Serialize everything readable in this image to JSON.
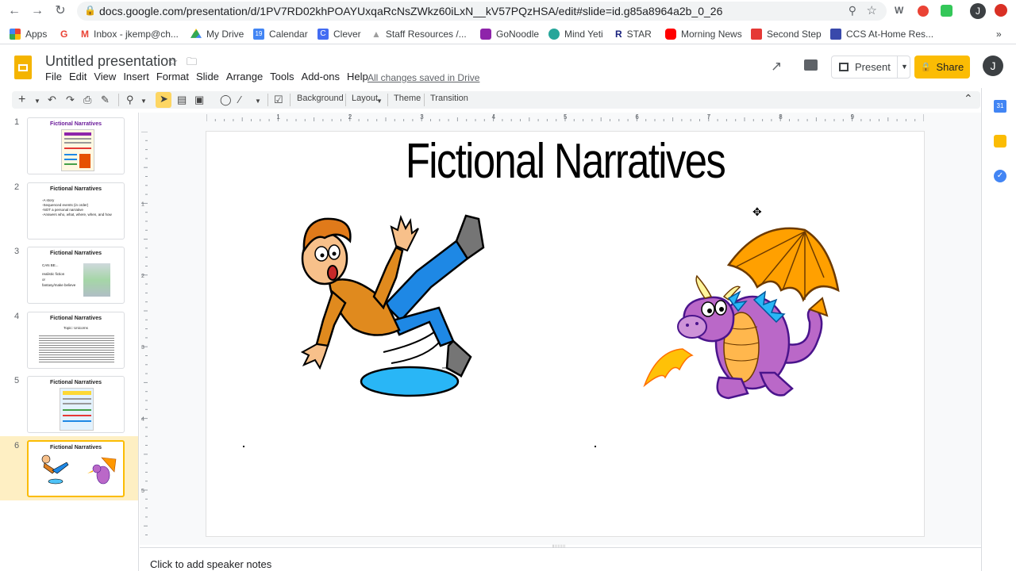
{
  "browser": {
    "url": "docs.google.com/presentation/d/1PV7RD02khPOAYUxqaRcNsZWkz60iLxN__kV57PQzHSA/edit#slide=id.g85a8964a2b_0_26",
    "bookmarks": [
      {
        "label": "Apps",
        "color": "#4285f4"
      },
      {
        "label": "Inbox - jkemp@ch...",
        "color": "#ea4335"
      },
      {
        "label": "My Drive",
        "color": "#34a853"
      },
      {
        "label": "Calendar",
        "color": "#4285f4"
      },
      {
        "label": "Clever",
        "color": "#436cf2"
      },
      {
        "label": "Staff Resources /...",
        "color": "#9e9e9e"
      },
      {
        "label": "GoNoodle",
        "color": "#8e24aa"
      },
      {
        "label": "Mind Yeti",
        "color": "#26a69a"
      },
      {
        "label": "STAR",
        "color": "#1a237e"
      },
      {
        "label": "Morning News",
        "color": "#ff0000"
      },
      {
        "label": "Second Step",
        "color": "#e53935"
      },
      {
        "label": "CCS At-Home Res...",
        "color": "#3949ab"
      }
    ],
    "more_bookmarks": "»",
    "profile_initial": "J"
  },
  "doc": {
    "title": "Untitled presentation",
    "menus": [
      "File",
      "Edit",
      "View",
      "Insert",
      "Format",
      "Slide",
      "Arrange",
      "Tools",
      "Add-ons",
      "Help"
    ],
    "saved_status": "All changes saved in Drive",
    "present_label": "Present",
    "share_label": "Share",
    "avatar_initial": "J"
  },
  "toolbar": {
    "background": "Background",
    "layout": "Layout",
    "theme": "Theme",
    "transition": "Transition"
  },
  "ruler": {
    "h_ticks": [
      "1",
      "2",
      "3",
      "4",
      "5",
      "6",
      "7",
      "8",
      "9"
    ],
    "v_ticks": [
      "1",
      "2",
      "3",
      "4",
      "5"
    ]
  },
  "slides": [
    {
      "num": "1",
      "title": "Fictional Narratives"
    },
    {
      "num": "2",
      "title": "Fictional Narratives",
      "lines": [
        "-A story",
        "-Sequenced events (in order)",
        "-NOT a personal narrative",
        "-Answers who, what, where, when, and how"
      ]
    },
    {
      "num": "3",
      "title": "Fictional Narratives",
      "lines": [
        "CAN BE...",
        "realistic fiction",
        "or",
        "fantasy/make believe"
      ]
    },
    {
      "num": "4",
      "title": "Fictional Narratives",
      "lines": [
        "Topic: Unicorns"
      ]
    },
    {
      "num": "5",
      "title": "Fictional Narratives"
    },
    {
      "num": "6",
      "title": "Fictional Narratives"
    }
  ],
  "current_slide": {
    "title": "Fictional Narratives"
  },
  "notes_placeholder": "Click to add speaker notes",
  "colors": {
    "share_yellow": "#fbbc04",
    "selected_slide_bg": "#feefc3"
  }
}
